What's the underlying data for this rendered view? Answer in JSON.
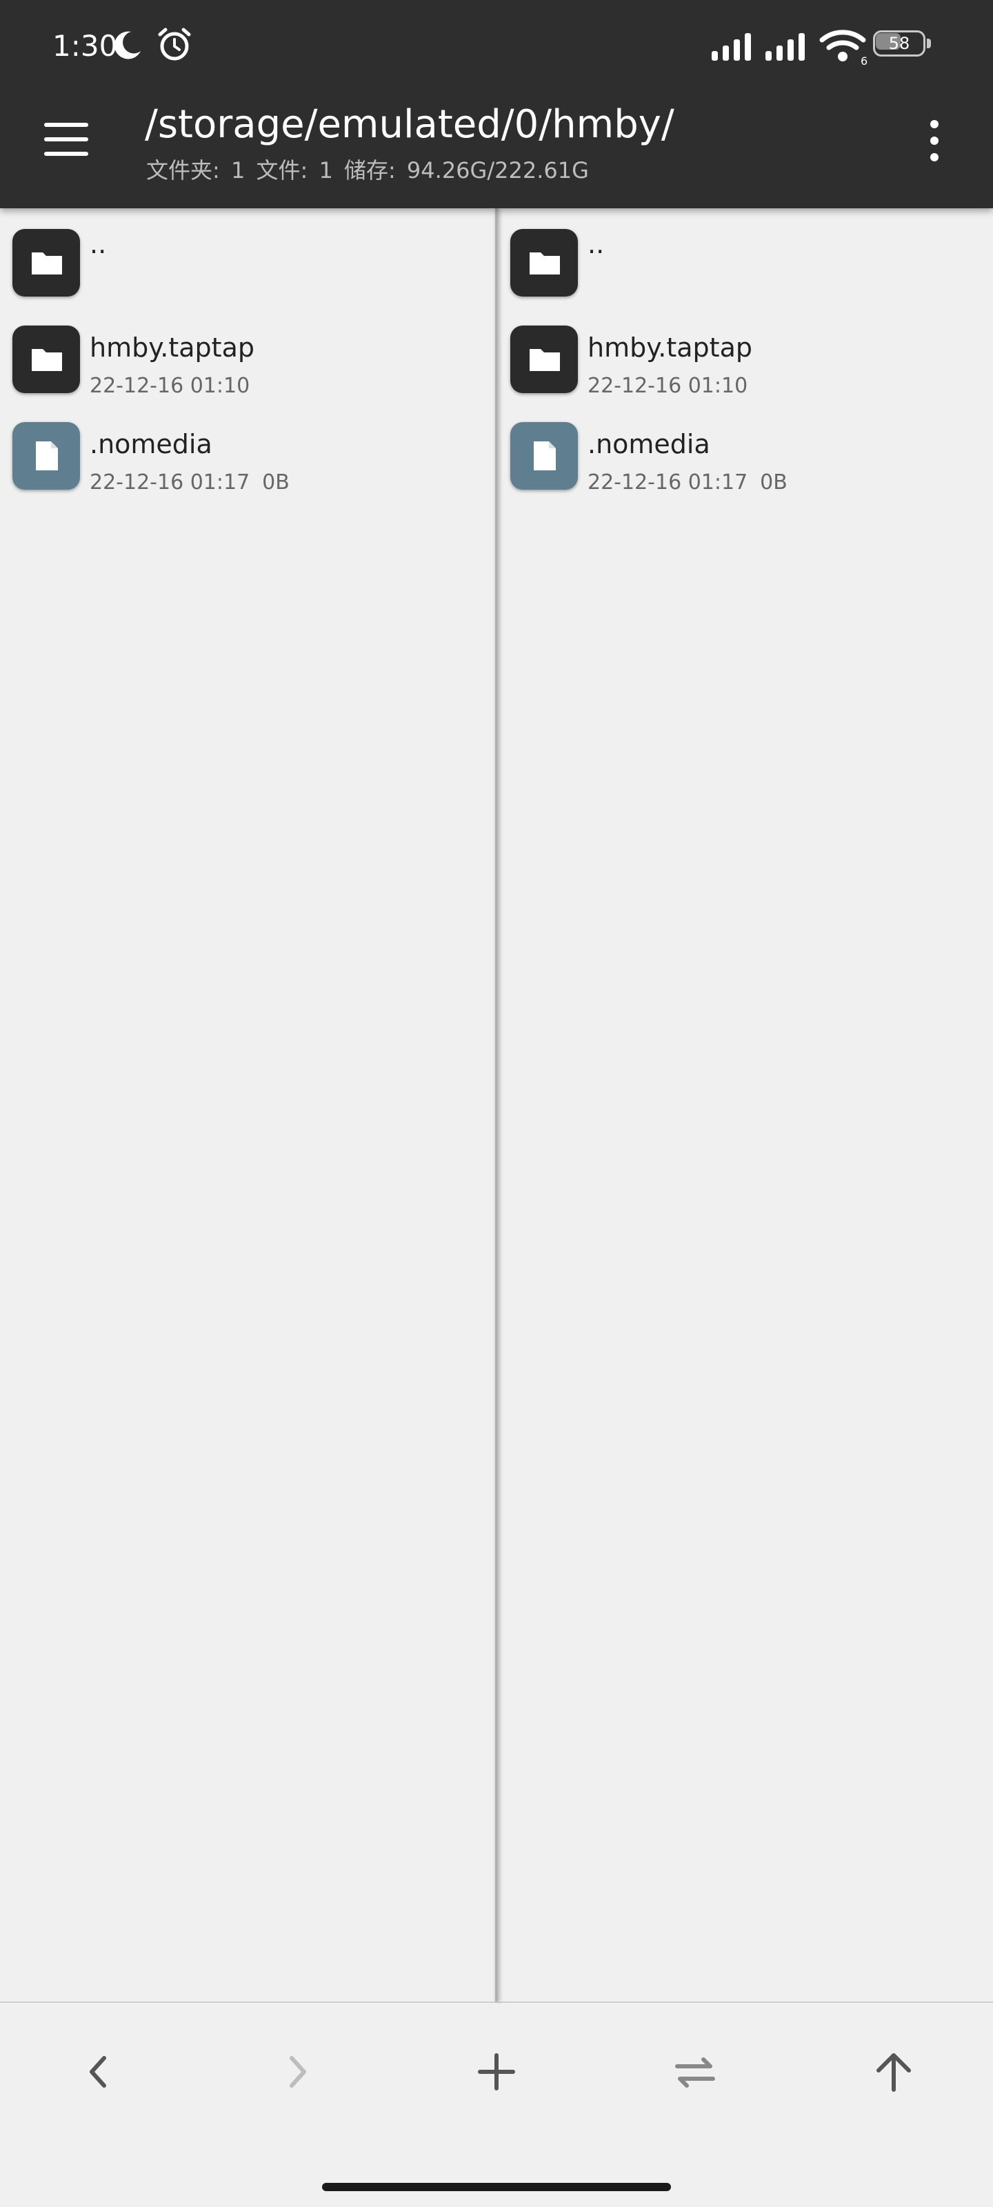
{
  "status_bar": {
    "time": "1:30",
    "battery": "58",
    "battery_level": 0.58,
    "wifi_label": "6",
    "icons": [
      "moon-icon",
      "alarm-icon",
      "signal-icon",
      "signal-icon",
      "wifi-icon",
      "battery-icon"
    ]
  },
  "header": {
    "path": "/storage/emulated/0/hmby/",
    "info": "文件夹: 1   文件: 1   储存: 94.26G/222.61G",
    "menu_icon": "hamburger-menu-icon",
    "more_icon": "more-vertical-icon"
  },
  "panes": [
    {
      "parent": {
        "name": ".."
      },
      "items": [
        {
          "name": "hmby.taptap",
          "date": "22-12-16 01:10",
          "size": "",
          "type": "folder"
        },
        {
          "name": ".nomedia",
          "date": "22-12-16 01:17",
          "size": "0B",
          "type": "file"
        }
      ]
    },
    {
      "parent": {
        "name": ".."
      },
      "items": [
        {
          "name": "hmby.taptap",
          "date": "22-12-16 01:10",
          "size": "",
          "type": "folder"
        },
        {
          "name": ".nomedia",
          "date": "22-12-16 01:17",
          "size": "0B",
          "type": "file"
        }
      ]
    }
  ],
  "toolbar": {
    "buttons": [
      "back-icon",
      "forward-icon",
      "add-icon",
      "swap-icon",
      "up-icon"
    ]
  },
  "colors": {
    "header_bg": "#2e2e2e",
    "pane_bg": "#f0f0f0",
    "folder_icon_bg": "#2a2a2a",
    "file_icon_bg": "#5f7f90"
  }
}
